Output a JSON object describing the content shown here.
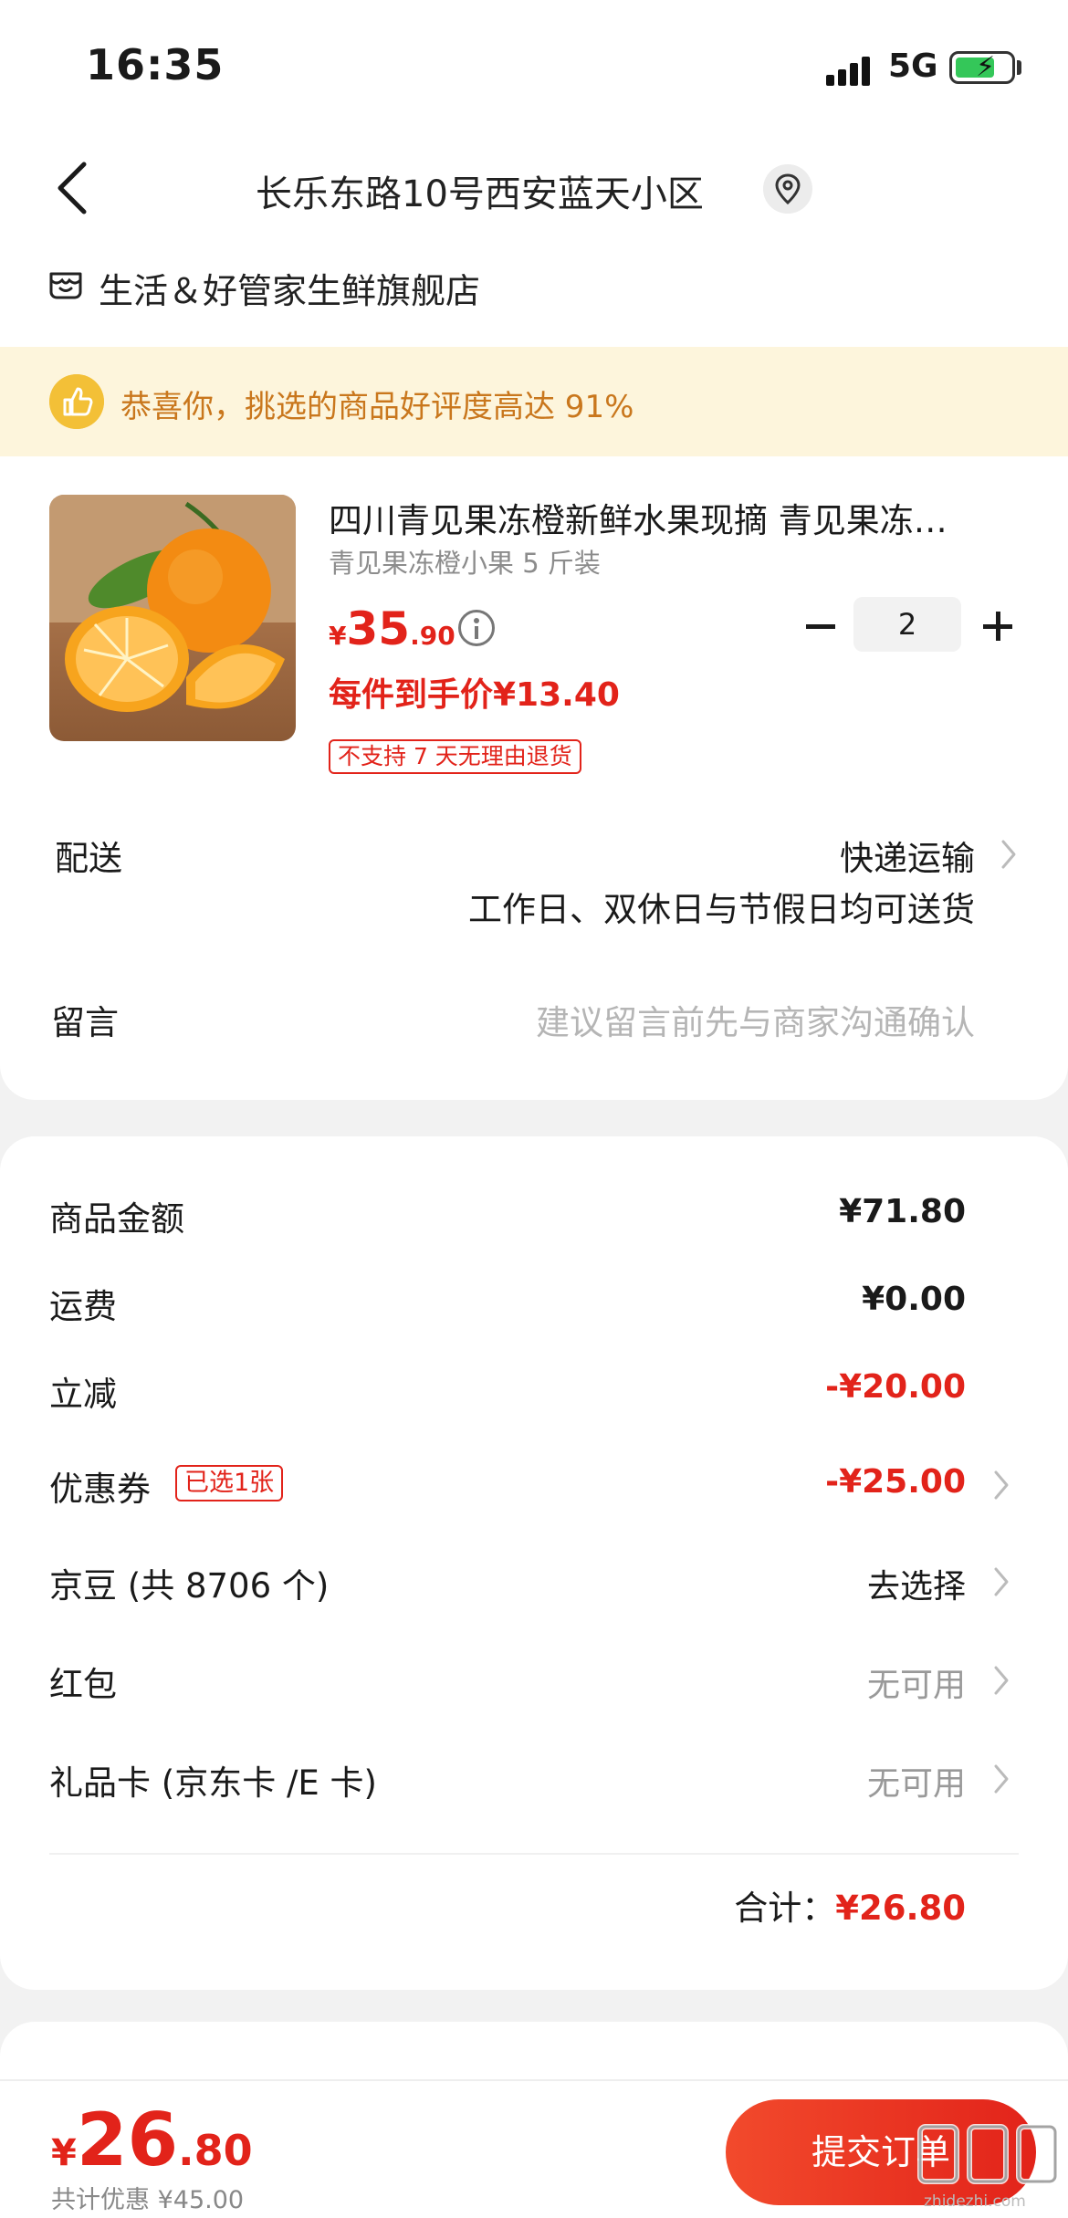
{
  "status": {
    "time": "16:35",
    "network": "5G"
  },
  "nav": {
    "address": "长乐东路10号西安蓝天小区"
  },
  "store": {
    "name": "生活＆好管家生鲜旗舰店"
  },
  "banner": {
    "text": "恭喜你，挑选的商品好评度高达 91%"
  },
  "product": {
    "title": "四川青见果冻橙新鲜水果现摘 青见果冻…",
    "spec": "青见果冻橙小果 5 斤装",
    "price_currency": "¥",
    "price_int": "35",
    "price_dec": ".90",
    "net_price": "每件到手价¥13.40",
    "quantity": "2",
    "tag": "不支持 7 天无理由退货"
  },
  "delivery": {
    "label": "配送",
    "method": "快递运输",
    "note": "工作日、双休日与节假日均可送货"
  },
  "message": {
    "label": "留言",
    "placeholder": "建议留言前先与商家沟通确认"
  },
  "costs": {
    "goods_label": "商品金额",
    "goods_value": "¥71.80",
    "freight_label": "运费",
    "freight_value": "¥0.00",
    "discount_label": "立减",
    "discount_value": "-¥20.00",
    "coupon_label": "优惠券",
    "coupon_badge": "已选1张",
    "coupon_value": "-¥25.00",
    "jingdou_label": "京豆 (共 8706 个)",
    "jingdou_value": "去选择",
    "redpacket_label": "红包",
    "redpacket_value": "无可用",
    "giftcard_label": "礼品卡 (京东卡 /E 卡)",
    "giftcard_value": "无可用",
    "total_label": "合计：",
    "total_value": "¥26.80"
  },
  "bottom": {
    "currency": "¥",
    "pay_int": "26",
    "pay_dec": ".80",
    "saved": "共计优惠 ¥45.00",
    "submit": "提交订单"
  },
  "watermark": {
    "text": "zhidezhi.com"
  },
  "colors": {
    "accent": "#e2231a",
    "banner_bg": "#fdf5dc",
    "banner_text": "#c9771d"
  }
}
